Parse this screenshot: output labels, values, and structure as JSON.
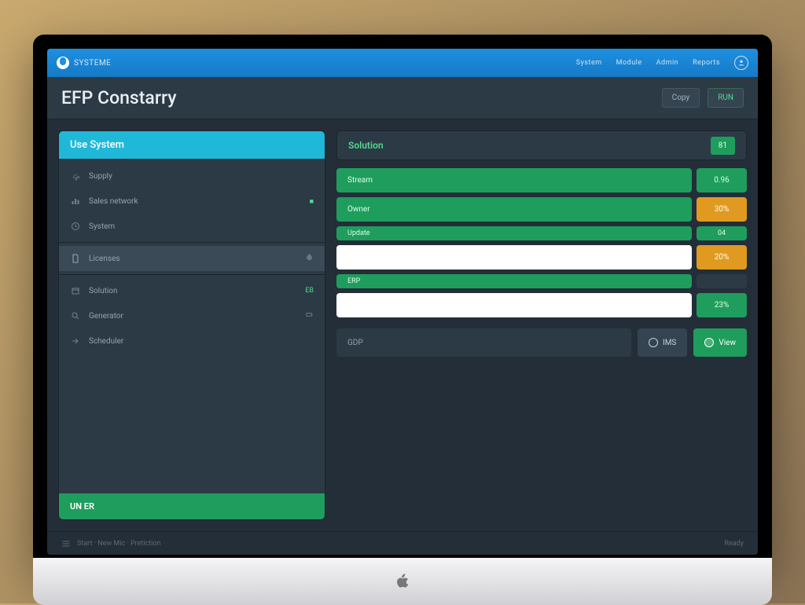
{
  "topbar": {
    "brand": "SYSTEME",
    "nav": [
      "System",
      "Module",
      "Admin",
      "Reports"
    ]
  },
  "title": "EFP Constarry",
  "title_actions": {
    "secondary": "Copy",
    "primary": "RUN"
  },
  "sidebar": {
    "header": "Use System",
    "items": [
      {
        "label": "Supply",
        "tag": "",
        "icon": "gear"
      },
      {
        "label": "Sales network",
        "tag": "■",
        "icon": "chart"
      },
      {
        "label": "System",
        "tag": "",
        "icon": "clock"
      },
      {
        "label": "Licenses",
        "tag": "",
        "icon": "doc",
        "active": true,
        "tag_icon": "printer"
      },
      {
        "label": "Solution",
        "tag": "EB",
        "icon": "box"
      },
      {
        "label": "Generator",
        "tag": "",
        "icon": "search",
        "tag_icon": "battery"
      },
      {
        "label": "Scheduler",
        "tag": "",
        "icon": "arrow"
      }
    ],
    "footer": "UN ER"
  },
  "panel": {
    "header": {
      "title": "Solution",
      "value": "81"
    },
    "rows": [
      {
        "label": "Stream",
        "value": "0.96",
        "variant": "green"
      },
      {
        "label": "Owner",
        "value": "30%",
        "variant": "orange"
      },
      {
        "label": "Update",
        "value": "04",
        "variant": "green",
        "short": true
      },
      {
        "label": "",
        "value": "20%",
        "variant": "input-orange"
      },
      {
        "label": "ERP",
        "value": "",
        "variant": "green",
        "short": true
      },
      {
        "label": "",
        "value": "23%",
        "variant": "input-green"
      }
    ],
    "footer_label": "GDP",
    "btn_secondary": "IMS",
    "btn_primary": "View"
  },
  "status": {
    "left": "Start · New Mic · Pretiction",
    "right": "Ready"
  }
}
